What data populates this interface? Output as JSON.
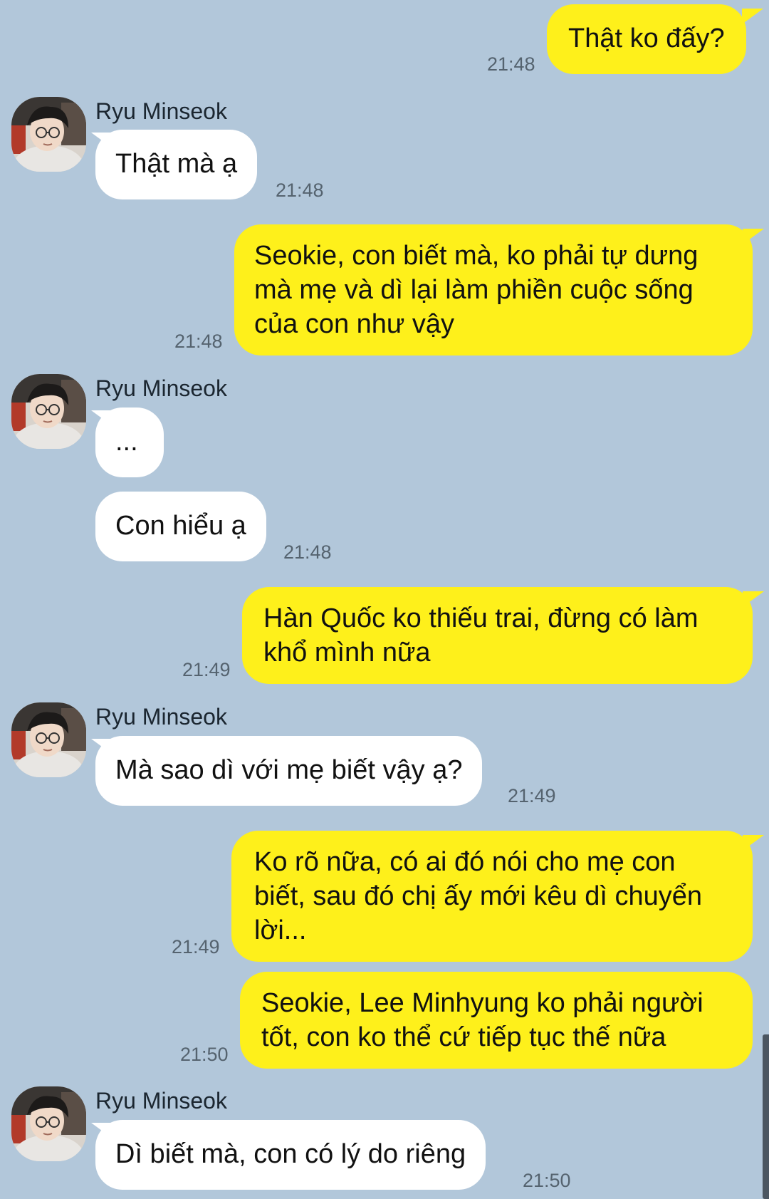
{
  "contact": {
    "name": "Ryu Minseok",
    "avatar_icon": "profile-photo"
  },
  "colors": {
    "background": "#b2c7da",
    "my_bubble": "#fef01b",
    "their_bubble": "#ffffff",
    "timestamp": "#55636f"
  },
  "messages": [
    {
      "sender": "me",
      "text": "Thật ko đấy?",
      "time": "21:48"
    },
    {
      "sender": "Ryu Minseok",
      "text": "Thật mà ạ",
      "time": "21:48"
    },
    {
      "sender": "me",
      "text": "Seokie, con biết mà, ko phải tự dưng mà mẹ và dì lại làm phiền cuộc sống của con như vậy",
      "time": "21:48"
    },
    {
      "sender": "Ryu Minseok",
      "text": "...",
      "time": ""
    },
    {
      "sender": "Ryu Minseok",
      "text": "Con hiểu ạ",
      "time": "21:48"
    },
    {
      "sender": "me",
      "text": "Hàn Quốc ko thiếu trai, đừng có làm khổ mình nữa",
      "time": "21:49"
    },
    {
      "sender": "Ryu Minseok",
      "text": "Mà sao dì với mẹ biết vậy ạ?",
      "time": "21:49"
    },
    {
      "sender": "me",
      "text": "Ko rõ nữa, có ai đó nói cho mẹ con biết, sau đó chị ấy mới kêu dì chuyển lời...",
      "time": "21:49"
    },
    {
      "sender": "me",
      "text": "Seokie, Lee Minhyung ko phải người tốt, con ko thể cứ tiếp tục thế nữa",
      "time": "21:50"
    },
    {
      "sender": "Ryu Minseok",
      "text": "Dì biết mà, con có lý do riêng",
      "time": "21:50"
    }
  ]
}
